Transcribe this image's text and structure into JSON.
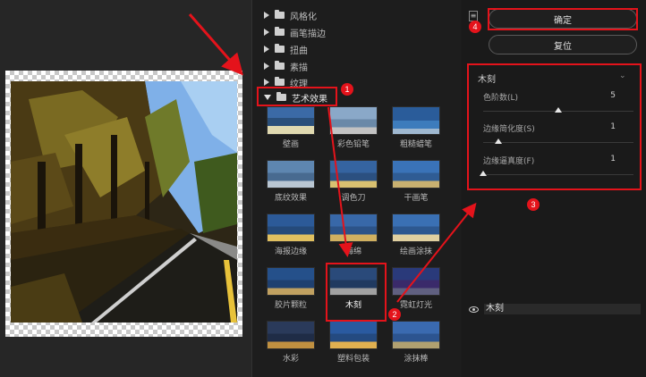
{
  "filter_categories": [
    {
      "label": "风格化",
      "expanded": false
    },
    {
      "label": "画笔描边",
      "expanded": false
    },
    {
      "label": "扭曲",
      "expanded": false
    },
    {
      "label": "素描",
      "expanded": false
    },
    {
      "label": "纹理",
      "expanded": false
    },
    {
      "label": "艺术效果",
      "expanded": true
    }
  ],
  "filters": [
    {
      "label": "壁画"
    },
    {
      "label": "彩色铅笔"
    },
    {
      "label": "粗糙蜡笔"
    },
    {
      "label": "底纹效果"
    },
    {
      "label": "调色刀"
    },
    {
      "label": "干画笔"
    },
    {
      "label": "海报边缘"
    },
    {
      "label": "海绵"
    },
    {
      "label": "绘画涂抹"
    },
    {
      "label": "胶片颗粒"
    },
    {
      "label": "木刻",
      "selected": true
    },
    {
      "label": "霓虹灯光"
    },
    {
      "label": "水彩"
    },
    {
      "label": "塑料包装"
    },
    {
      "label": "涂抹棒"
    }
  ],
  "buttons": {
    "ok": "确定",
    "reset": "复位",
    "toggle": "≡"
  },
  "settings": {
    "title": "木刻",
    "chevron": "⌄",
    "params": [
      {
        "label": "色阶数(L)",
        "value": "5",
        "fraction": 0.5
      },
      {
        "label": "边缘简化度(S)",
        "value": "1",
        "fraction": 0.1
      },
      {
        "label": "边缘逼真度(F)",
        "value": "1",
        "fraction": 0.0
      }
    ]
  },
  "layer": {
    "name": "木刻"
  },
  "annotations": {
    "badge1": "1",
    "badge2": "2",
    "badge3": "3",
    "badge4": "4"
  },
  "colors": {
    "highlight": "#e4131b",
    "panel_bg": "#1d1d1d"
  }
}
